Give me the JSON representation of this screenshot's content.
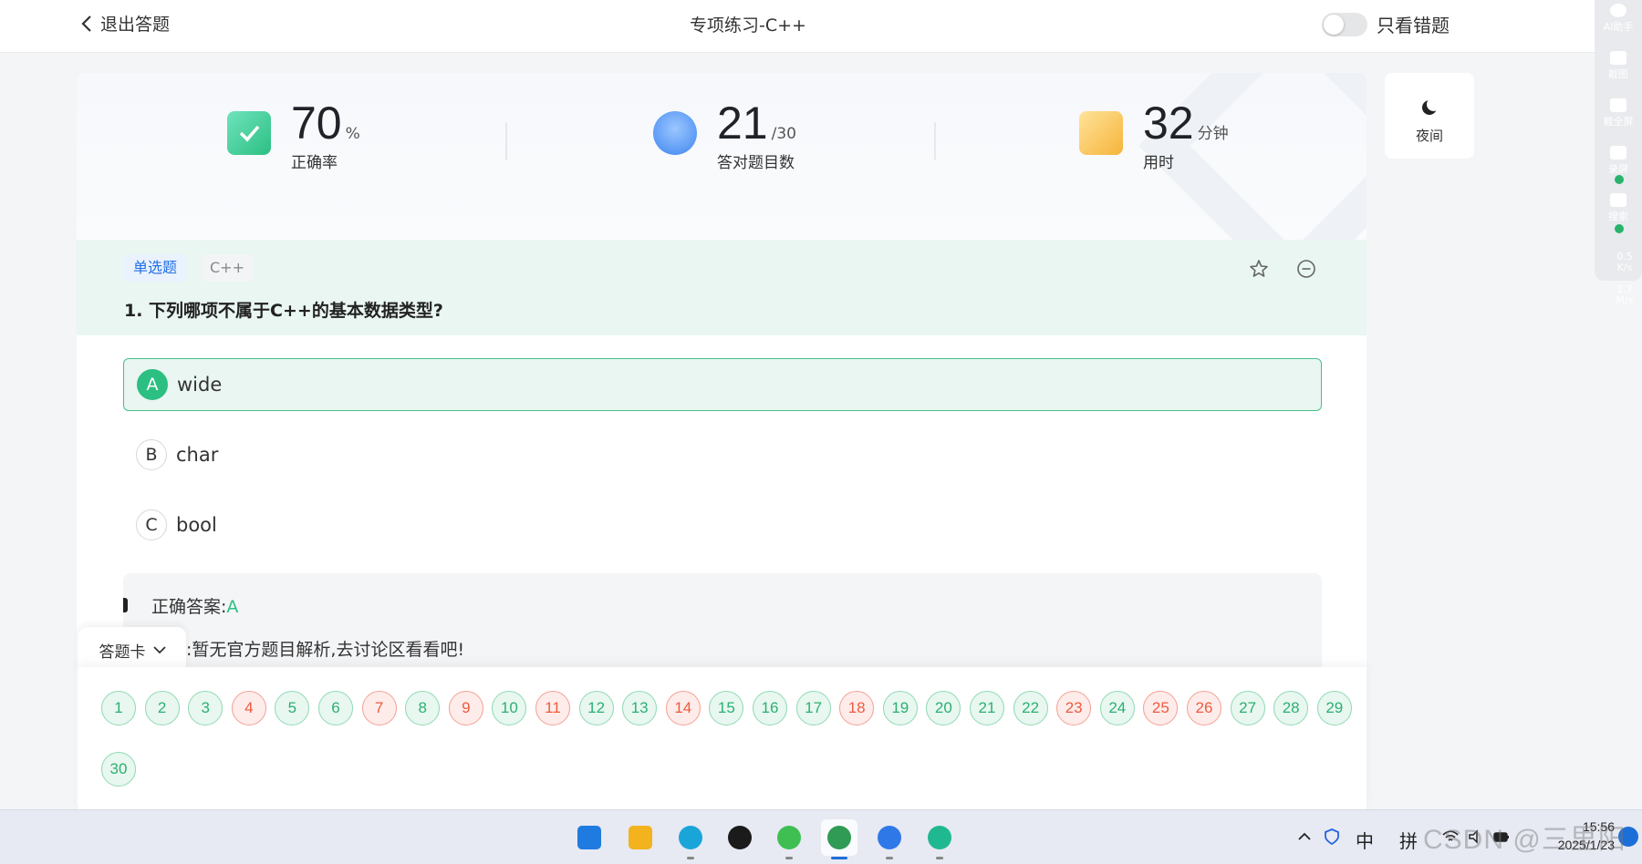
{
  "header": {
    "back_label": "退出答题",
    "title": "专项练习-C++",
    "wrong_only_label": "只看错题"
  },
  "side_tools": {
    "items": [
      {
        "label": "AI助手"
      },
      {
        "label": "截图"
      },
      {
        "label": "截全屏"
      },
      {
        "label": "录屏"
      },
      {
        "label": "搜索"
      }
    ],
    "speeds": [
      {
        "value": "0.5",
        "unit": "K/s"
      },
      {
        "value": "1.7",
        "unit": "M/s"
      }
    ]
  },
  "stats": {
    "accuracy": {
      "value": "70",
      "unit": "%",
      "label": "正确率"
    },
    "correct": {
      "value": "21",
      "unit": "/30",
      "label": "答对题目数"
    },
    "time": {
      "value": "32",
      "unit": "分钟",
      "label": "用时"
    }
  },
  "question": {
    "type_tag": "单选题",
    "lang_tag": "C++",
    "text": "1. 下列哪项不属于C++的基本数据类型?",
    "options": [
      {
        "letter": "A",
        "text": "wide",
        "state": "correct"
      },
      {
        "letter": "B",
        "text": "char",
        "state": "normal"
      },
      {
        "letter": "C",
        "text": "bool",
        "state": "normal"
      }
    ],
    "answer_label": "正确答案:",
    "answer_value": "A",
    "analysis": "解析:暂无官方题目解析,去讨论区看看吧!"
  },
  "answer_card": {
    "tab_label": "答题卡",
    "numbers": [
      {
        "n": "1",
        "status": "ok"
      },
      {
        "n": "2",
        "status": "ok"
      },
      {
        "n": "3",
        "status": "ok"
      },
      {
        "n": "4",
        "status": "bad"
      },
      {
        "n": "5",
        "status": "ok"
      },
      {
        "n": "6",
        "status": "ok"
      },
      {
        "n": "7",
        "status": "bad"
      },
      {
        "n": "8",
        "status": "ok"
      },
      {
        "n": "9",
        "status": "bad"
      },
      {
        "n": "10",
        "status": "ok"
      },
      {
        "n": "11",
        "status": "bad"
      },
      {
        "n": "12",
        "status": "ok"
      },
      {
        "n": "13",
        "status": "ok"
      },
      {
        "n": "14",
        "status": "bad"
      },
      {
        "n": "15",
        "status": "ok"
      },
      {
        "n": "16",
        "status": "ok"
      },
      {
        "n": "17",
        "status": "ok"
      },
      {
        "n": "18",
        "status": "bad"
      },
      {
        "n": "19",
        "status": "ok"
      },
      {
        "n": "20",
        "status": "ok"
      },
      {
        "n": "21",
        "status": "ok"
      },
      {
        "n": "22",
        "status": "ok"
      },
      {
        "n": "23",
        "status": "bad"
      },
      {
        "n": "24",
        "status": "ok"
      },
      {
        "n": "25",
        "status": "bad"
      },
      {
        "n": "26",
        "status": "bad"
      },
      {
        "n": "27",
        "status": "ok"
      },
      {
        "n": "28",
        "status": "ok"
      },
      {
        "n": "29",
        "status": "ok"
      },
      {
        "n": "30",
        "status": "ok"
      }
    ]
  },
  "night_mode": {
    "label": "夜间"
  },
  "taskbar": {
    "apps": [
      {
        "name": "windows-start",
        "color": "#1f7be0"
      },
      {
        "name": "file-explorer",
        "color": "#f2b31e"
      },
      {
        "name": "edge",
        "color": "#1aa5d8"
      },
      {
        "name": "qq",
        "color": "#1b1b1b"
      },
      {
        "name": "wechat",
        "color": "#3fbf52"
      },
      {
        "name": "remote-desktop",
        "color": "#2f9b55"
      },
      {
        "name": "blue-app",
        "color": "#2f78e8"
      },
      {
        "name": "green-app",
        "color": "#20b890"
      }
    ],
    "ime_mode": "中",
    "ime_input": "拼",
    "time": "15:56",
    "date": "2025/1/23"
  },
  "watermark": "CSDN @三里阳",
  "colors": {
    "accent_green": "#2cbf82",
    "wrong_red": "#ef5b3f",
    "question_bg": "#e9f6f1"
  }
}
